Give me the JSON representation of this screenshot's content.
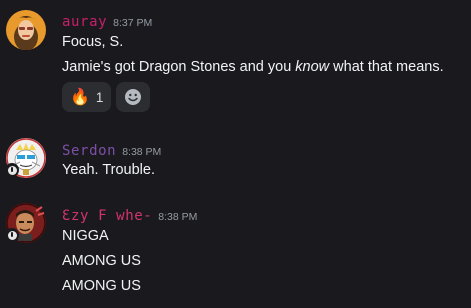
{
  "messages": [
    {
      "username": "auray",
      "username_color": "#c71f6b",
      "timestamp": "8:37 PM",
      "lines": [
        "Focus, S."
      ],
      "rich_line": {
        "before": "Jamie's got Dragon Stones and you ",
        "emphasis": "know",
        "after": " what that means."
      },
      "reactions": [
        {
          "emoji": "🔥",
          "count": "1"
        }
      ]
    },
    {
      "username": "Serdon",
      "username_color": "#7d4fa8",
      "timestamp": "8:38 PM",
      "lines": [
        "Yeah. Trouble."
      ]
    },
    {
      "username": "Ɛzy F whe-",
      "username_color": "#d2336e",
      "timestamp": "8:38 PM",
      "lines": [
        "NIGGA",
        "AMONG US",
        "AMONG US"
      ]
    }
  ]
}
